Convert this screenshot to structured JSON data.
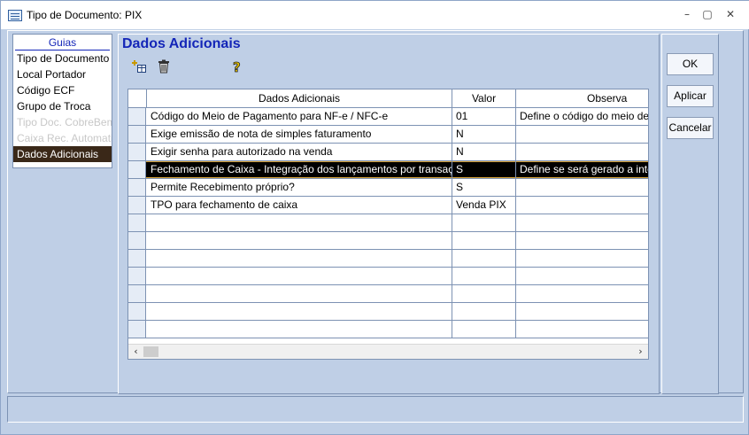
{
  "window": {
    "title": "Tipo de Documento: PIX",
    "minimize_icon": "minimize-icon",
    "maximize_icon": "maximize-icon",
    "close_icon": "close-icon"
  },
  "sidebar": {
    "header": "Guias",
    "items": [
      {
        "label": "Tipo de Documento",
        "state": "normal"
      },
      {
        "label": "Local Portador",
        "state": "normal"
      },
      {
        "label": "Código ECF",
        "state": "normal"
      },
      {
        "label": "Grupo de Troca",
        "state": "normal"
      },
      {
        "label": "Tipo Doc. CobreBem",
        "state": "disabled"
      },
      {
        "label": "Caixa Rec. Automatic",
        "state": "disabled"
      },
      {
        "label": "Dados Adicionais",
        "state": "selected"
      }
    ]
  },
  "main": {
    "section_title": "Dados Adicionais",
    "toolbar": {
      "add_icon": "add-row-icon",
      "delete_icon": "trash-icon",
      "help_icon": "help-icon"
    },
    "grid": {
      "columns": [
        "Dados Adicionais",
        "Valor",
        "Observa"
      ],
      "rows": [
        {
          "dado": "Código do Meio de Pagamento para NF-e / NFC-e",
          "valor": "01",
          "obs": "Define o código do meio de pa"
        },
        {
          "dado": "Exige emissão de nota de simples faturamento",
          "valor": "N",
          "obs": ""
        },
        {
          "dado": "Exigir senha para autorizado na venda",
          "valor": "N",
          "obs": ""
        },
        {
          "dado": "Fechamento de Caixa - Integração dos lançamentos por transação?",
          "valor": "S",
          "obs": "Define se será gerado a integr"
        },
        {
          "dado": "Permite Recebimento próprio?",
          "valor": "S",
          "obs": ""
        },
        {
          "dado": "TPO para fechamento de caixa",
          "valor": "Venda PIX",
          "obs": ""
        }
      ],
      "selected_row": 3,
      "empty_rows": 7,
      "scroll_left": "‹",
      "scroll_right": "›"
    }
  },
  "buttons": {
    "ok": "OK",
    "apply": "Aplicar",
    "cancel": "Cancelar"
  },
  "colors": {
    "accent": "#1426b8",
    "window_bg": "#bfcfe6",
    "selected_bg": "#000000",
    "sidebar_selected": "#3a2818"
  }
}
